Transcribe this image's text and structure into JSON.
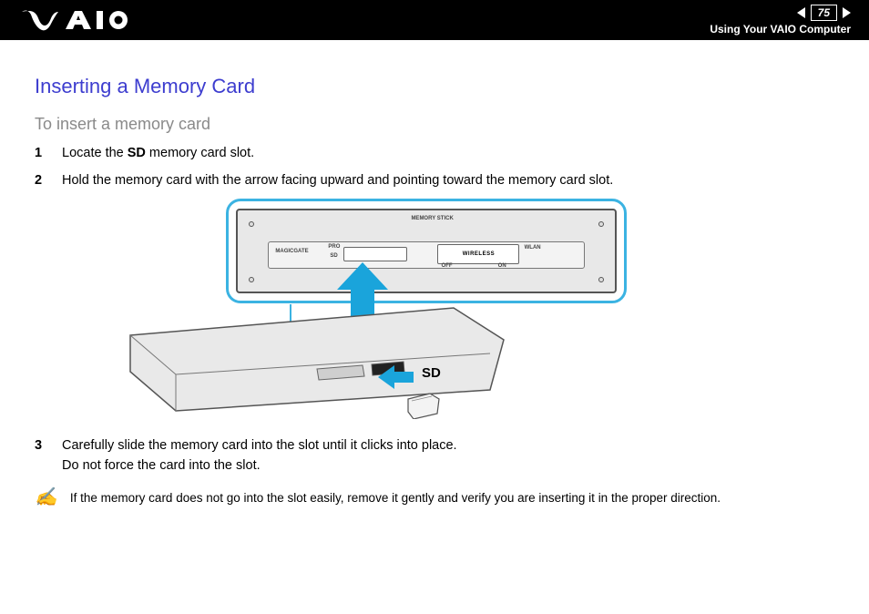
{
  "header": {
    "page_number": "75",
    "section_title": "Using Your VAIO Computer"
  },
  "title": "Inserting a Memory Card",
  "subtitle": "To insert a memory card",
  "steps": {
    "s1": {
      "num": "1",
      "pre": "Locate the ",
      "bold": "SD",
      "post": " memory card slot."
    },
    "s2": {
      "num": "2",
      "text": "Hold the memory card with the arrow facing upward and pointing toward the memory card slot."
    },
    "s3": {
      "num": "3",
      "line1": "Carefully slide the memory card into the slot until it clicks into place.",
      "line2": "Do not force the card into the slot."
    }
  },
  "figure": {
    "sd_label": "SD",
    "callout_labels": {
      "memorystick": "MEMORY STICK",
      "magicgate": "MAGICGATE",
      "pro": "PRO",
      "sd": "SD",
      "wireless": "WIRELESS",
      "wlan": "WLAN",
      "off": "OFF",
      "on": "ON"
    }
  },
  "note": {
    "icon": "✍",
    "text": "If the memory card does not go into the slot easily, remove it gently and verify you are inserting it in the proper direction."
  }
}
